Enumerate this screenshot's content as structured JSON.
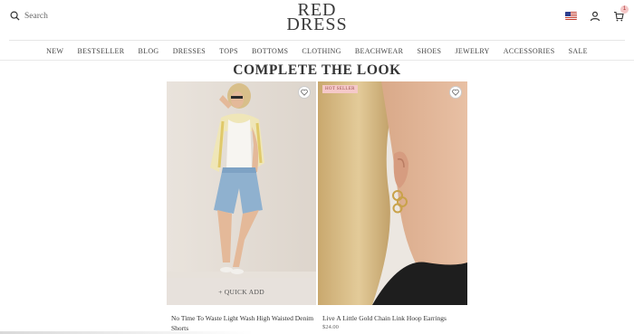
{
  "header": {
    "search_placeholder": "Search",
    "logo_line1": "RED",
    "logo_line2": "DRESS",
    "cart_count": "1"
  },
  "nav": {
    "items": [
      "NEW",
      "BESTSELLER",
      "BLOG",
      "DRESSES",
      "TOPS",
      "BOTTOMS",
      "CLOTHING",
      "BEACHWEAR",
      "SHOES",
      "JEWELRY",
      "ACCESSORIES",
      "SALE"
    ]
  },
  "section": {
    "title": "COMPLETE THE LOOK"
  },
  "products": [
    {
      "name": "No Time To Waste Light Wash High Waisted Denim Shorts",
      "price": "",
      "quick_add": "+ QUICK ADD",
      "badge": ""
    },
    {
      "name": "Live A Little Gold Chain Link Hoop Earrings",
      "price": "$24.00",
      "quick_add": "",
      "badge": "HOT SELLER"
    }
  ],
  "icons": {
    "search": "search-icon",
    "flag": "us-flag-icon",
    "account": "user-icon",
    "cart": "cart-icon",
    "wishlist": "heart-icon"
  },
  "colors": {
    "badge_bg": "#f5c9c9",
    "text": "#333333",
    "divider": "#e6e6e6"
  }
}
